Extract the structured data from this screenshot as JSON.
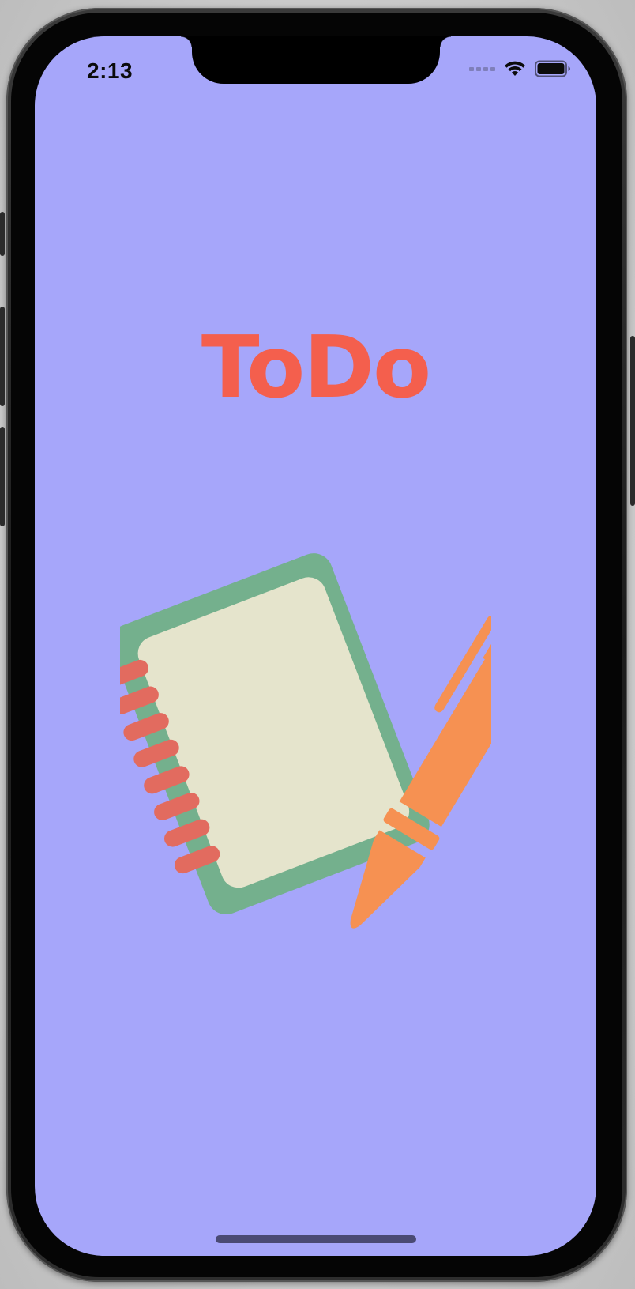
{
  "status_bar": {
    "time": "2:13",
    "signal_icon": "cellular-dots-icon",
    "wifi_icon": "wifi-icon",
    "battery_icon": "battery-icon"
  },
  "app": {
    "title": "ToDo",
    "illustration": "notebook-with-pen-icon"
  },
  "colors": {
    "background": "#a6a6fa",
    "title": "#f45f4d",
    "notebook_cover": "#74b08d",
    "notebook_page": "#e5e4cc",
    "spiral_rings": "#e26b5f",
    "pen": "#f69152"
  }
}
